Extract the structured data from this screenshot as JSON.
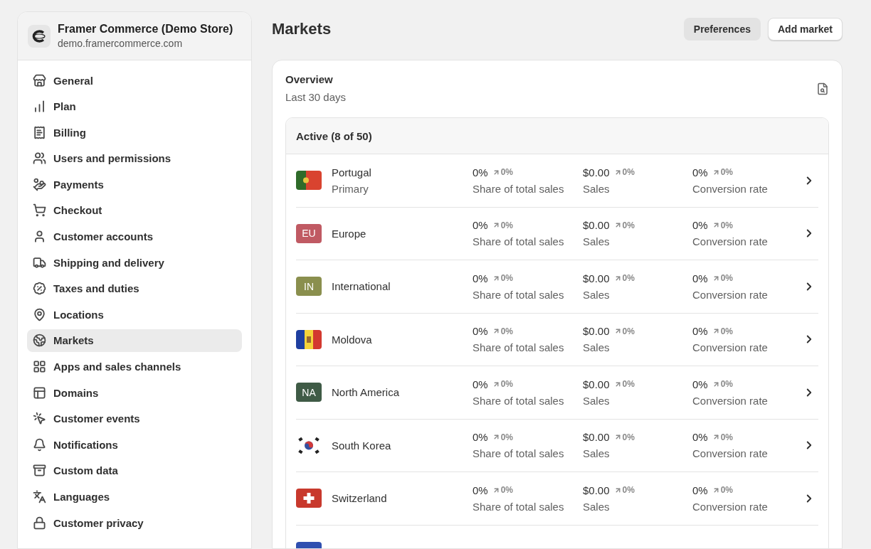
{
  "store": {
    "name": "Framer Commerce (Demo Store)",
    "domain": "demo.framercommerce.com"
  },
  "sidebar": {
    "items": [
      {
        "label": "General",
        "selected": false
      },
      {
        "label": "Plan",
        "selected": false
      },
      {
        "label": "Billing",
        "selected": false
      },
      {
        "label": "Users and permissions",
        "selected": false
      },
      {
        "label": "Payments",
        "selected": false
      },
      {
        "label": "Checkout",
        "selected": false
      },
      {
        "label": "Customer accounts",
        "selected": false
      },
      {
        "label": "Shipping and delivery",
        "selected": false
      },
      {
        "label": "Taxes and duties",
        "selected": false
      },
      {
        "label": "Locations",
        "selected": false
      },
      {
        "label": "Markets",
        "selected": true
      },
      {
        "label": "Apps and sales channels",
        "selected": false
      },
      {
        "label": "Domains",
        "selected": false
      },
      {
        "label": "Customer events",
        "selected": false
      },
      {
        "label": "Notifications",
        "selected": false
      },
      {
        "label": "Custom data",
        "selected": false
      },
      {
        "label": "Languages",
        "selected": false
      },
      {
        "label": "Customer privacy",
        "selected": false
      }
    ]
  },
  "page": {
    "title": "Markets",
    "buttons": [
      {
        "label": "Preferences",
        "kind": "secondary"
      },
      {
        "label": "Add market",
        "kind": "outline"
      }
    ]
  },
  "overview": {
    "title": "Overview",
    "period": "Last 30 days"
  },
  "markets": {
    "heading": "Active (8 of 50)",
    "rows": [
      {
        "name": "Portugal",
        "note": "Primary",
        "kind": "portugal",
        "metrics": [
          {
            "value": "0%",
            "change": "0%",
            "label": "Share of total sales"
          },
          {
            "value": "$0.00",
            "change": "0%",
            "label": "Sales"
          },
          {
            "value": "0%",
            "change": "0%",
            "label": "Conversion rate"
          }
        ]
      },
      {
        "name": "Europe",
        "kind": "badge",
        "badge": "EU",
        "color": "#c05a63",
        "metrics": [
          {
            "value": "0%",
            "change": "0%",
            "label": "Share of total sales"
          },
          {
            "value": "$0.00",
            "change": "0%",
            "label": "Sales"
          },
          {
            "value": "0%",
            "change": "0%",
            "label": "Conversion rate"
          }
        ]
      },
      {
        "name": "International",
        "kind": "badge",
        "badge": "IN",
        "color": "#8a8f4e",
        "metrics": [
          {
            "value": "0%",
            "change": "0%",
            "label": "Share of total sales"
          },
          {
            "value": "$0.00",
            "change": "0%",
            "label": "Sales"
          },
          {
            "value": "0%",
            "change": "0%",
            "label": "Conversion rate"
          }
        ]
      },
      {
        "name": "Moldova",
        "kind": "moldova",
        "metrics": [
          {
            "value": "0%",
            "change": "0%",
            "label": "Share of total sales"
          },
          {
            "value": "$0.00",
            "change": "0%",
            "label": "Sales"
          },
          {
            "value": "0%",
            "change": "0%",
            "label": "Conversion rate"
          }
        ]
      },
      {
        "name": "North America",
        "kind": "badge",
        "badge": "NA",
        "color": "#3f5b46",
        "metrics": [
          {
            "value": "0%",
            "change": "0%",
            "label": "Share of total sales"
          },
          {
            "value": "$0.00",
            "change": "0%",
            "label": "Sales"
          },
          {
            "value": "0%",
            "change": "0%",
            "label": "Conversion rate"
          }
        ]
      },
      {
        "name": "South Korea",
        "kind": "korea",
        "metrics": [
          {
            "value": "0%",
            "change": "0%",
            "label": "Share of total sales"
          },
          {
            "value": "$0.00",
            "change": "0%",
            "label": "Sales"
          },
          {
            "value": "0%",
            "change": "0%",
            "label": "Conversion rate"
          }
        ]
      },
      {
        "name": "Switzerland",
        "kind": "switzerland",
        "metrics": [
          {
            "value": "0%",
            "change": "0%",
            "label": "Share of total sales"
          },
          {
            "value": "$0.00",
            "change": "0%",
            "label": "Sales"
          },
          {
            "value": "0%",
            "change": "0%",
            "label": "Conversion rate"
          }
        ]
      },
      {
        "kind": "blue"
      }
    ]
  }
}
